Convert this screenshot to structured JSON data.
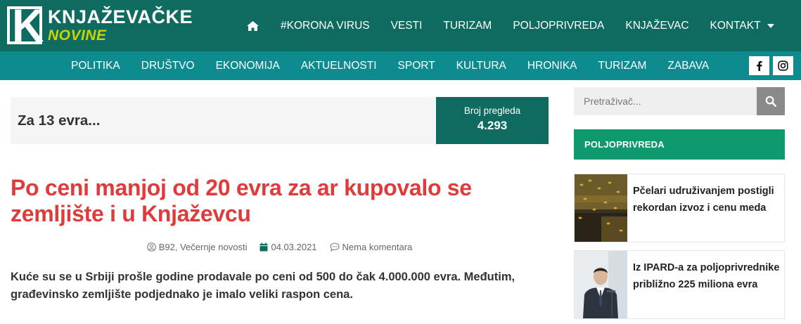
{
  "header": {
    "logo": {
      "title": "KNJAŽEVAČKE",
      "subtitle": "NOVINE",
      "mark": "K"
    },
    "nav": {
      "home_icon": "home-icon",
      "items": [
        {
          "label": "#KORONA VIRUS"
        },
        {
          "label": "VESTI"
        },
        {
          "label": "TURIZAM"
        },
        {
          "label": "POLJOPRIVREDA"
        },
        {
          "label": "KNJAŽEVAC"
        },
        {
          "label": "KONTAKT",
          "has_dropdown": true
        }
      ]
    }
  },
  "subnav": {
    "items": [
      {
        "label": "POLITIKA"
      },
      {
        "label": "DRUŠTVO"
      },
      {
        "label": "EKONOMIJA"
      },
      {
        "label": "AKTUELNOSTI"
      },
      {
        "label": "SPORT"
      },
      {
        "label": "KULTURA"
      },
      {
        "label": "HRONIKA"
      },
      {
        "label": "TURIZAM"
      },
      {
        "label": "ZABAVA"
      }
    ],
    "social": [
      "facebook-icon",
      "instagram-icon"
    ]
  },
  "views": {
    "teaser": "Za 13 evra...",
    "label": "Broj pregleda",
    "value": "4.293"
  },
  "article": {
    "title": "Po ceni manjoj od 20 evra za ar kupovalo se zemljište i u Knjaževcu",
    "author": "B92, Večernje novosti",
    "date": "04.03.2021",
    "comments": "Nema komentara",
    "lead": "Kuće su se u Srbiji prošle godine prodavale po ceni od 500 do čak 4.000.000 evra. Međutim, građevinsko zemljište podjednako je imalo veliki raspon cena."
  },
  "sidebar": {
    "search": {
      "placeholder": "Pretraživač...",
      "value": ""
    },
    "section_title": "POLJOPRIVREDA",
    "posts": [
      {
        "title": "Pčelari udruživanjem postigli rekordan izvoz i cenu meda"
      },
      {
        "title": "Iz IPARD-a za poljoprivrednike približno 225 miliona evra"
      }
    ]
  },
  "colors": {
    "header": "#0f6b5f",
    "subnav": "#0e8b8f",
    "title_red": "#e03a3a",
    "section_green": "#0e9a6e",
    "logo_accent": "#c8d500"
  }
}
